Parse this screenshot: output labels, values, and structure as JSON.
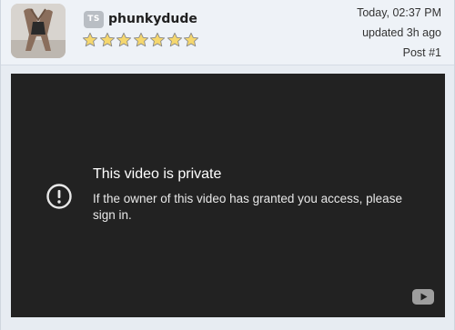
{
  "post": {
    "author": {
      "rank_badge": "TS",
      "username": "phunkydude",
      "rating": 7,
      "rating_max": 7
    },
    "meta": {
      "date": "Today, 02:37 PM",
      "updated": "updated 3h ago",
      "post_number": "Post #1"
    },
    "video": {
      "title": "This video is private",
      "message": "If the owner of this video has granted you access, please sign in.",
      "icon": "alert-circle-icon",
      "logo": "youtube-logo-icon"
    }
  },
  "colors": {
    "star": "#f5d76e",
    "star_stroke": "#8a8a8a",
    "video_bg": "#222222",
    "header_bg": "#eef2f7"
  }
}
